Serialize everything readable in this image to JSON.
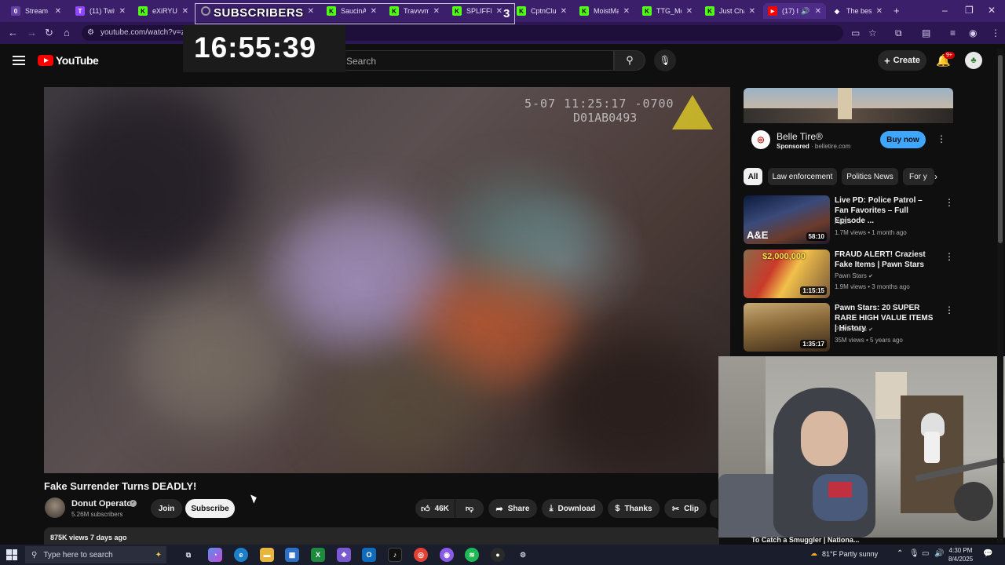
{
  "browser": {
    "tabs": [
      {
        "label": "Stream -",
        "color": "#6441a5",
        "glyph": "0"
      },
      {
        "label": "(11) Twitc",
        "color": "#9146ff",
        "glyph": "T"
      },
      {
        "label": "eXiRYU S",
        "color": "#53fc18",
        "glyph": "K"
      },
      {
        "label": "",
        "color": "#888888",
        "glyph": ""
      },
      {
        "label": "SaucinAn",
        "color": "#53fc18",
        "glyph": "K"
      },
      {
        "label": "Travvvm",
        "color": "#53fc18",
        "glyph": "K"
      },
      {
        "label": "SPLIFFM",
        "color": "#53fc18",
        "glyph": "K"
      },
      {
        "label": "CptnClut",
        "color": "#53fc18",
        "glyph": "K"
      },
      {
        "label": "MoistMa",
        "color": "#53fc18",
        "glyph": "K"
      },
      {
        "label": "TTG_McL",
        "color": "#53fc18",
        "glyph": "K"
      },
      {
        "label": "Just Chat",
        "color": "#53fc18",
        "glyph": "K"
      },
      {
        "label": "(17) I",
        "color": "#ff0000",
        "glyph": "▶"
      },
      {
        "label": "The best",
        "color": "#ffffff",
        "glyph": "◆"
      }
    ],
    "url": "youtube.com/watch?v=z0",
    "new_tab": "+",
    "close_tab": "✕"
  },
  "overlay": {
    "subscribers_label": "SUBSCRIBERS",
    "subscribers_count": "3",
    "timer": "16:55:39"
  },
  "youtube": {
    "logo_text": "YouTube",
    "search_placeholder": "Search",
    "create_label": "Create",
    "notif_badge": "9+"
  },
  "video": {
    "cam_timestamp": "5-07 11:25:17 -0700",
    "cam_device": "D01AB0493",
    "title": "Fake Surrender Turns DEADLY!",
    "channel_name": "Donut Operator",
    "channel_subs": "5.26M subscribers",
    "join_label": "Join",
    "subscribe_label": "Subscribe",
    "likes": "46K",
    "share_label": "Share",
    "download_label": "Download",
    "thanks_label": "Thanks",
    "clip_label": "Clip",
    "views_date": "875K views  7 days ago"
  },
  "ad": {
    "name": "Belle Tire®",
    "sponsored": "Sponsored",
    "domain": "belletire.com",
    "cta": "Buy now"
  },
  "chips": [
    "All",
    "Law enforcement",
    "Politics News",
    "For y"
  ],
  "recommendations": [
    {
      "title": "Live PD: Police Patrol – Fan Favorites – Full Episode ...",
      "channel": "A&E",
      "meta": "1.7M views • 1 month ago",
      "duration": "58:10"
    },
    {
      "title": "FRAUD ALERT! Craziest Fake Items | Pawn Stars",
      "channel": "Pawn Stars",
      "meta": "1.9M views • 3 months ago",
      "duration": "1:15:15"
    },
    {
      "title": "Pawn Stars: 20 SUPER RARE HIGH VALUE ITEMS | History",
      "channel": "Pawn Stars",
      "meta": "35M views • 5 years ago",
      "duration": "1:35:17"
    }
  ],
  "partial_rec_title": "To Catch a Smuggler | Nationa...",
  "taskbar": {
    "search_placeholder": "Type here to search",
    "weather": "81°F  Partly sunny",
    "time": "4:30 PM",
    "date": "8/4/2025"
  }
}
